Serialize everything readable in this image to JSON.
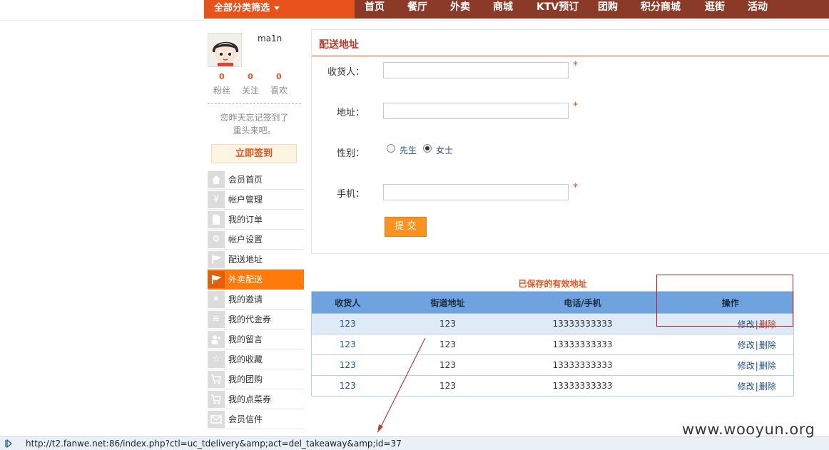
{
  "topnav": {
    "category_button": "全部分类筛选",
    "items": [
      "首页",
      "餐厅",
      "外卖",
      "商城",
      "KTV预订",
      "团购",
      "积分商城",
      "逛街",
      "活动"
    ]
  },
  "profile": {
    "username": "ma1n",
    "stats": [
      {
        "value": "0",
        "label": "粉丝"
      },
      {
        "value": "0",
        "label": "关注"
      },
      {
        "value": "0",
        "label": "喜欢"
      }
    ],
    "signin_tip_line1": "您昨天忘记签到了",
    "signin_tip_line2": "重头来吧。",
    "signin_button": "立即签到"
  },
  "menu": [
    {
      "label": "会员首页",
      "icon": "home-icon"
    },
    {
      "label": "帐户管理",
      "icon": "yen-icon"
    },
    {
      "label": "我的订单",
      "icon": "document-icon"
    },
    {
      "label": "帐户设置",
      "icon": "gear-icon"
    },
    {
      "label": "配送地址",
      "icon": "flag-icon"
    },
    {
      "label": "外卖配送",
      "icon": "flag-icon",
      "active": true
    },
    {
      "label": "我的邀请",
      "icon": "sparkle-icon"
    },
    {
      "label": "我的代金券",
      "icon": "layers-icon"
    },
    {
      "label": "我的留言",
      "icon": "users-icon"
    },
    {
      "label": "我的收藏",
      "icon": "star-icon"
    },
    {
      "label": "我的团购",
      "icon": "cart-icon"
    },
    {
      "label": "我的点菜券",
      "icon": "cart-icon"
    },
    {
      "label": "会员信件",
      "icon": "mail-icon"
    }
  ],
  "form": {
    "title": "配送地址",
    "name_label": "收货人：",
    "name_value": "",
    "address_label": "地址：",
    "address_value": "",
    "gender_label": "性别：",
    "gender_options": [
      "先生",
      "女士"
    ],
    "gender_selected": "女士",
    "phone_label": "手机：",
    "phone_value": "",
    "required_mark": "*",
    "submit": "提 交"
  },
  "saved": {
    "title": "已保存的有效地址",
    "columns": [
      "收货人",
      "街道地址",
      "电话/手机",
      "操作"
    ],
    "rows": [
      {
        "name": "123",
        "street": "123",
        "phone": "13333333333",
        "edit": "修改",
        "sep": "|",
        "delete": "删除"
      },
      {
        "name": "123",
        "street": "123",
        "phone": "13333333333",
        "edit": "修改",
        "sep": "|",
        "delete": "删除"
      },
      {
        "name": "123",
        "street": "123",
        "phone": "13333333333",
        "edit": "修改",
        "sep": "|",
        "delete": "删除"
      },
      {
        "name": "123",
        "street": "123",
        "phone": "13333333333",
        "edit": "修改",
        "sep": "|",
        "delete": "删除"
      }
    ]
  },
  "statusbar": {
    "url": "http://t2.fanwe.net:86/index.php?ctl=uc_tdelivery&amp;act=del_takeaway&amp;id=37"
  },
  "watermark": "www.wooyun.org",
  "colors": {
    "accent": "#e8531c",
    "nav_bg": "#8a3a26",
    "active_menu": "#ff7a0a",
    "table_header": "#6fa3e0",
    "annotation": "#d11a1a"
  }
}
